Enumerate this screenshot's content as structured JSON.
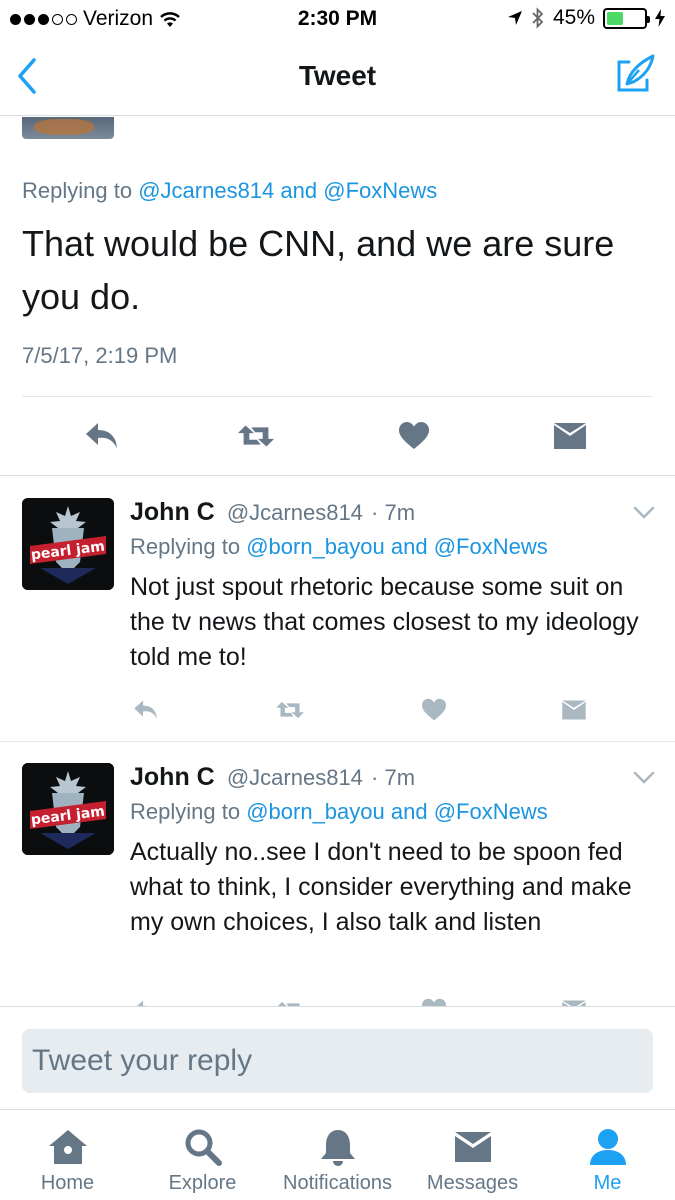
{
  "status_bar": {
    "carrier": "Verizon",
    "time": "2:30 PM",
    "battery_percent": "45%",
    "battery_level": 0.45
  },
  "nav": {
    "title": "Tweet",
    "back_icon": "chevron-left-icon",
    "compose_icon": "compose-tweet-icon"
  },
  "main_tweet": {
    "reply_prefix": "Replying to",
    "reply_mention_1": "@Jcarnes814",
    "reply_and": "and",
    "reply_mention_2": "@FoxNews",
    "text": "That would be CNN, and we are sure you do.",
    "timestamp": "7/5/17, 2:19 PM"
  },
  "replies": [
    {
      "name": "John C",
      "handle": "@Jcarnes814",
      "age": "· 7m",
      "reply_prefix": "Replying to",
      "reply_mention_1": "@born_bayou",
      "reply_and": "and",
      "reply_mention_2": "@FoxNews",
      "text": "Not just spout rhetoric because some suit on the tv news that comes closest to my ideology told me to!",
      "avatar_text": "pearl jam"
    },
    {
      "name": "John C",
      "handle": "@Jcarnes814",
      "age": "· 7m",
      "reply_prefix": "Replying to",
      "reply_mention_1": "@born_bayou",
      "reply_and": "and",
      "reply_mention_2": "@FoxNews",
      "text": "Actually no..see I don't need to be spoon fed what to think, I consider everything and make my own choices, I also talk and listen",
      "avatar_text": "pearl jam"
    }
  ],
  "composer": {
    "placeholder": "Tweet your reply"
  },
  "tabs": [
    {
      "label": "Home",
      "icon": "home-icon"
    },
    {
      "label": "Explore",
      "icon": "search-icon"
    },
    {
      "label": "Notifications",
      "icon": "bell-icon"
    },
    {
      "label": "Messages",
      "icon": "envelope-icon"
    },
    {
      "label": "Me",
      "icon": "person-icon"
    }
  ],
  "colors": {
    "accent": "#1da1f2",
    "link": "#1b95e0",
    "secondary_text": "#657786",
    "icon_gray": "#8899a6",
    "main_action_icon": "#657786"
  }
}
